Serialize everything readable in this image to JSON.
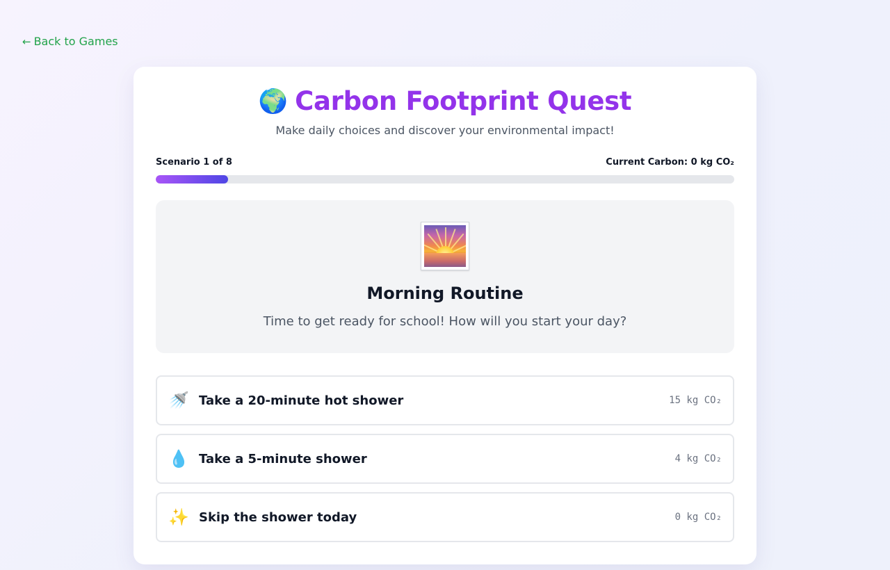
{
  "nav": {
    "back_arrow": "←",
    "back_label": "Back to Games"
  },
  "header": {
    "icon": "🌍",
    "title": "Carbon Footprint Quest",
    "subtitle": "Make daily choices and discover your environmental impact!"
  },
  "progress": {
    "scenario_label": "Scenario 1 of 8",
    "carbon_label": "Current Carbon: 0 kg CO₂",
    "fill_fraction": 0.125
  },
  "scenario": {
    "icon": "sunrise-icon",
    "title": "Morning Routine",
    "description": "Time to get ready for school! How will you start your day?"
  },
  "choices": [
    {
      "icon": "🚿",
      "label": "Take a 20-minute hot shower",
      "co2": "15 kg CO₂"
    },
    {
      "icon": "💧",
      "label": "Take a 5-minute shower",
      "co2": "4 kg CO₂"
    },
    {
      "icon": "✨",
      "label": "Skip the shower today",
      "co2": "0 kg CO₂"
    }
  ],
  "colors": {
    "accent": "#9333ea",
    "link": "#22a34a",
    "progress_start": "#a855f7",
    "progress_end": "#4f46e5"
  }
}
